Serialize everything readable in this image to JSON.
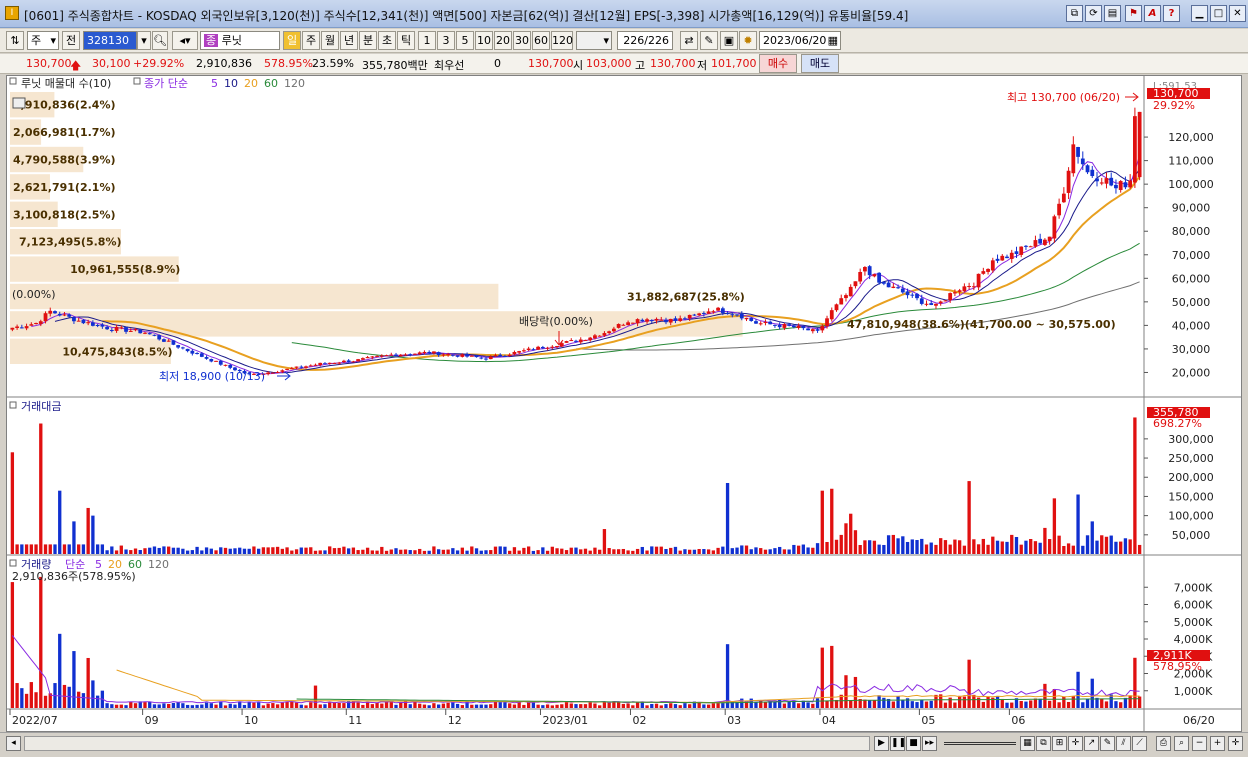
{
  "window": {
    "title": "[0601] 주식종합차트 - KOSDAQ 외국인보유[3,120(천)] 주식수[12,341(천)] 액면[500] 자본금[62(억)] 결산[12월] EPS[-3,398] 시가총액[16,129(억)] 유통비율[59.4]",
    "app_icon": "I",
    "controls": [
      "restore-icon",
      "refresh-icon",
      "setup-icon",
      "flag-icon",
      "font-icon",
      "help-icon",
      "minimize-icon",
      "maximize-icon",
      "close-icon"
    ]
  },
  "toolbar": {
    "period_select": "주",
    "prev_label": "전",
    "code": "328130",
    "stock_type_badge": "종",
    "stock_name": "루닛",
    "periods": [
      "일",
      "주",
      "월",
      "년",
      "분",
      "초",
      "틱"
    ],
    "active_period": "일",
    "intervals": [
      "1",
      "3",
      "5",
      "10",
      "20",
      "30",
      "60",
      "120"
    ],
    "count": "226",
    "count_total": "/226",
    "date": "2023/06/20"
  },
  "quote": {
    "price": "130,700",
    "change": "30,100",
    "change_pct": "+29.92%",
    "volume": "2,910,836",
    "volume_ratio": "578.95%",
    "turnover": "23.59%",
    "amount": "355,780백만",
    "best_label": "최우선",
    "best_value": "0",
    "ask_price": "130,700",
    "open_label": "시",
    "open": "103,000",
    "high_label": "고",
    "high": "130,700",
    "low_label": "저",
    "low": "101,700",
    "buy_label": "매수",
    "sell_label": "매도"
  },
  "colors": {
    "up": "#e01010",
    "down": "#1030d0",
    "ma5": "#8a2be2",
    "ma10": "#1a1a8a",
    "ma20": "#e8a020",
    "ma60": "#2a8a3a",
    "ma120": "#707070",
    "tag_bg": "#f5e2c8"
  },
  "price_pane": {
    "legend_name": "루닛 매물대 수(10)",
    "legend_ma": "종가 단순",
    "ma_periods": [
      "5",
      "10",
      "20",
      "60",
      "120"
    ],
    "ymax_label": "L:591.53",
    "y_ticks": [
      "120,000",
      "110,000",
      "100,000",
      "90,000",
      "80,000",
      "70,000",
      "60,000",
      "50,000",
      "40,000",
      "30,000",
      "20,000"
    ],
    "y_values": [
      120000,
      110000,
      100000,
      90000,
      80000,
      70000,
      60000,
      50000,
      40000,
      30000,
      20000
    ],
    "current_price_tag": "130,700",
    "current_pct_tag": "29.92%",
    "high_annotation": "최고 130,700 (06/20)",
    "low_annotation": "최저 18,900 (10/13)",
    "dividend_annotation": "배당락(0.00%)",
    "start_annotation": "(0.00%)",
    "volume_profile": [
      {
        "label": "2,910,836(2.4%)",
        "frac": 0.04
      },
      {
        "label": "2,066,981(1.7%)",
        "frac": 0.028
      },
      {
        "label": "4,790,588(3.9%)",
        "frac": 0.066
      },
      {
        "label": "2,621,791(2.1%)",
        "frac": 0.036
      },
      {
        "label": "3,100,818(2.5%)",
        "frac": 0.043
      },
      {
        "label": "7,123,495(5.8%)",
        "frac": 0.1
      },
      {
        "label": "10,961,555(8.9%)",
        "frac": 0.152
      },
      {
        "label": "31,882,687(25.8%)",
        "frac": 0.44
      },
      {
        "label": "47,810,948(38.6%)(41,700.00 ~ 30,575.00)",
        "frac": 0.66
      },
      {
        "label": "10,475,843(8.5%)",
        "frac": 0.145
      }
    ]
  },
  "amount_pane": {
    "legend": "거래대금",
    "y_ticks": [
      "300,000",
      "250,000",
      "200,000",
      "150,000",
      "100,000",
      "50,000"
    ],
    "y_values": [
      300000,
      250000,
      200000,
      150000,
      100000,
      50000
    ],
    "last_tag": "355,780",
    "last_pct": "698.27%"
  },
  "volume_pane": {
    "legend": "거래량",
    "legend_ma": "단순",
    "ma_periods": [
      "5",
      "20",
      "60",
      "120"
    ],
    "sub_legend": "2,910,836주(578.95%)",
    "y_ticks": [
      "7,000K",
      "6,000K",
      "5,000K",
      "4,000K",
      "3,000K",
      "2,000K",
      "1,000K"
    ],
    "y_values": [
      7000,
      6000,
      5000,
      4000,
      3000,
      2000,
      1000
    ],
    "last_tag": "2,911K",
    "last_pct": "578.95%"
  },
  "x_axis": {
    "labels": [
      "2022/07",
      "09",
      "10",
      "11",
      "12",
      "2023/01",
      "02",
      "03",
      "04",
      "05",
      "06"
    ],
    "label_index": [
      0,
      28,
      49,
      71,
      92,
      112,
      131,
      151,
      171,
      192,
      211
    ],
    "last_date": "06/20"
  },
  "chart_data": {
    "type": "candlestick",
    "x_start": "2022-07-01",
    "x_end": "2023-06-20",
    "ylim": [
      10000,
      140000
    ],
    "series": [
      {
        "name": "루닛",
        "keypoints": [
          [
            0,
            39000
          ],
          [
            5,
            41000
          ],
          [
            8,
            46000
          ],
          [
            14,
            42000
          ],
          [
            20,
            39000
          ],
          [
            28,
            37000
          ],
          [
            35,
            31000
          ],
          [
            41,
            26000
          ],
          [
            46,
            22000
          ],
          [
            50,
            19000
          ],
          [
            54,
            20000
          ],
          [
            60,
            22000
          ],
          [
            66,
            24000
          ],
          [
            72,
            25000
          ],
          [
            80,
            27500
          ],
          [
            88,
            28500
          ],
          [
            95,
            27000
          ],
          [
            100,
            26000
          ],
          [
            105,
            28000
          ],
          [
            110,
            30000
          ],
          [
            115,
            32000
          ],
          [
            120,
            34000
          ],
          [
            125,
            37000
          ],
          [
            130,
            42000
          ],
          [
            135,
            43000
          ],
          [
            140,
            42000
          ],
          [
            144,
            44000
          ],
          [
            148,
            47000
          ],
          [
            153,
            45000
          ],
          [
            157,
            41000
          ],
          [
            162,
            40000
          ],
          [
            166,
            39000
          ],
          [
            170,
            37000
          ],
          [
            173,
            46000
          ],
          [
            177,
            55000
          ],
          [
            180,
            65000
          ],
          [
            183,
            58000
          ],
          [
            187,
            55000
          ],
          [
            191,
            51000
          ],
          [
            195,
            48000
          ],
          [
            199,
            55000
          ],
          [
            203,
            58000
          ],
          [
            207,
            68000
          ],
          [
            211,
            70000
          ],
          [
            215,
            74000
          ],
          [
            219,
            78000
          ],
          [
            222,
            98000
          ],
          [
            224,
            117000
          ],
          [
            227,
            105000
          ],
          [
            230,
            103000
          ],
          [
            233,
            98000
          ],
          [
            236,
            102000
          ],
          [
            237,
            130700
          ]
        ]
      }
    ]
  }
}
